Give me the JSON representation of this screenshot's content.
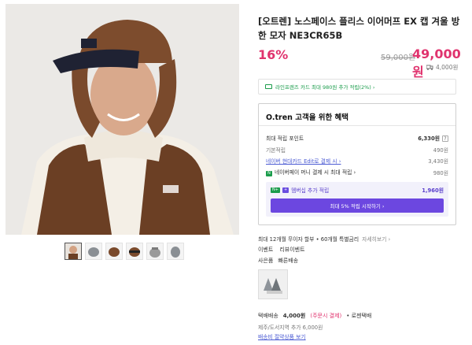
{
  "product": {
    "title": "[오트렌] 노스페이스 플리스 이어머프 EX 캡 겨울 방한 모자 NE3CR65B",
    "discount": "16%",
    "original_price": "59,000원",
    "price": "49,000원",
    "shipping_fee": "4,000원"
  },
  "card_banner": "라인프렌즈 카드 최대 980원 추가 적립(2%) ›",
  "benefit": {
    "title": "O.tren 고객을 위한 혜택",
    "max_label": "최대 적립 포인트",
    "max_value": "6,330원",
    "q": "?",
    "basic_label": "기본적립",
    "basic_value": "490원",
    "card_label": "네이버 현대카드 Edit로 결제 시 ›",
    "card_value": "3,430원",
    "npay_icon": "N",
    "npay_label": "네이버페이 머니 결제 시 최대 적립 ›",
    "npay_value": "980원",
    "member_tag1": "N+",
    "member_tag2": "+",
    "member_label": "멤버십 추가 적립",
    "member_value": "1,960원",
    "member_button": "최대 5% 적립 시작하기 ›"
  },
  "installment": "최대 12개월 무이자 할부 • 60개월 특별금리",
  "installment_more": "자세히보기 ›",
  "tags1": [
    "이벤트",
    "리뷰이벤트"
  ],
  "tags2": [
    "사은품",
    "빠른배송"
  ],
  "shipping": {
    "label": "택배배송",
    "fee": "4,000원",
    "note": "(주문시 결제)",
    "carrier": "• 로젠택배",
    "jeju": "제주/도서지역 추가 6,000원",
    "save_link": "배송비 절약상품 보기"
  },
  "colors": {
    "accent": "#e0336e",
    "purple": "#6c47e0",
    "green": "#1a9c4b",
    "link": "#4b5bd3"
  }
}
